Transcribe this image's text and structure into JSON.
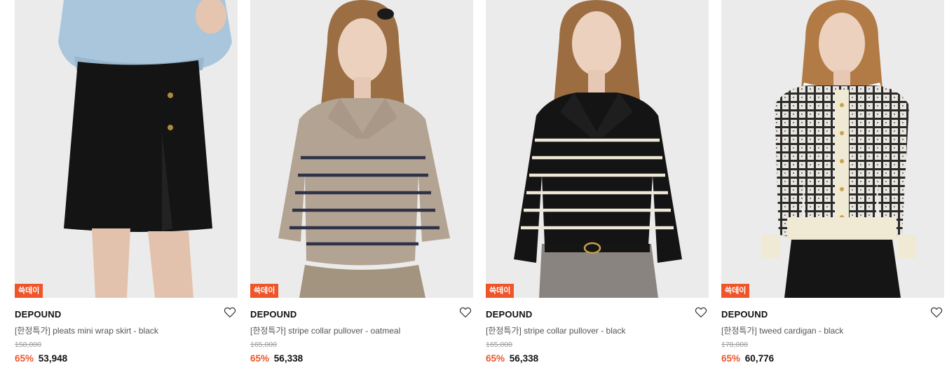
{
  "products": [
    {
      "badge": "쓱데이",
      "brand": "DEPOUND",
      "name": "[한정특가] pleats mini wrap skirt - black",
      "original_price": "158,000",
      "discount": "65%",
      "price": "53,948",
      "image": "pleats-mini-wrap-skirt-black"
    },
    {
      "badge": "쓱데이",
      "brand": "DEPOUND",
      "name": "[한정특가] stripe collar pullover - oatmeal",
      "original_price": "165,000",
      "discount": "65%",
      "price": "56,338",
      "image": "stripe-collar-pullover-oatmeal"
    },
    {
      "badge": "쓱데이",
      "brand": "DEPOUND",
      "name": "[한정특가] stripe collar pullover - black",
      "original_price": "165,000",
      "discount": "65%",
      "price": "56,338",
      "image": "stripe-collar-pullover-black"
    },
    {
      "badge": "쓱데이",
      "brand": "DEPOUND",
      "name": "[한정특가] tweed cardigan - black",
      "original_price": "178,000",
      "discount": "65%",
      "price": "60,776",
      "image": "tweed-cardigan-black"
    }
  ],
  "colors": {
    "accent": "#f0552a",
    "photo_background": "#ebebeb"
  },
  "icons": {
    "wishlist": "heart-icon"
  }
}
